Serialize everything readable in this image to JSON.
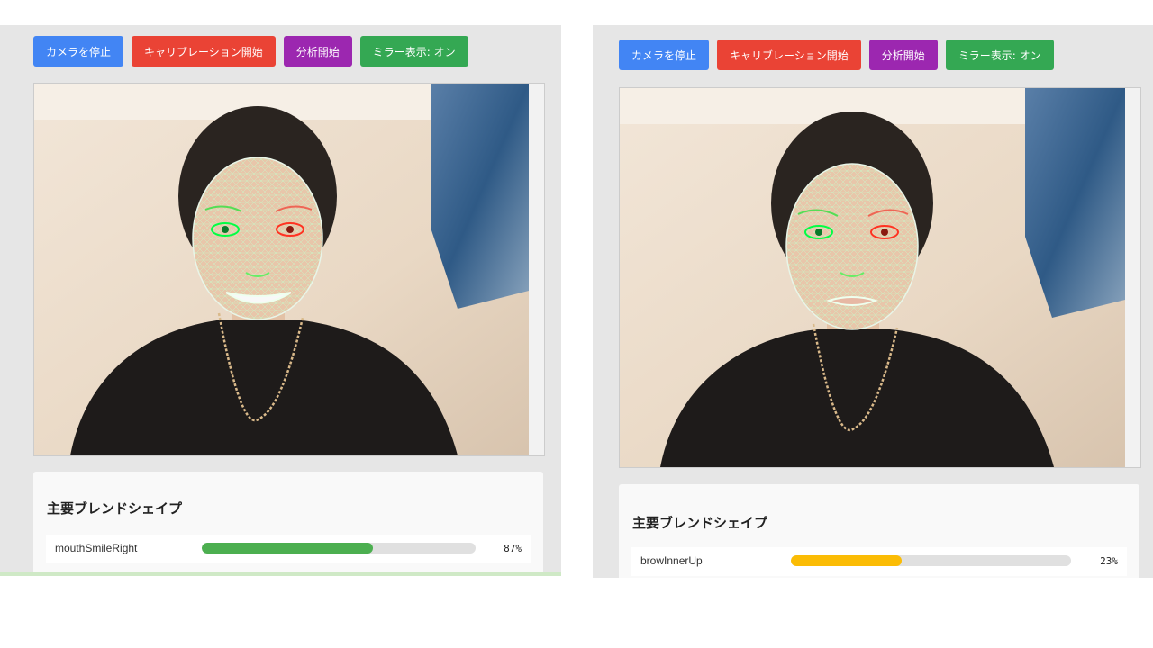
{
  "left_panel": {
    "buttons": {
      "stop_camera": "カメラを停止",
      "start_calibration": "キャリブレーション開始",
      "start_analysis": "分析開始",
      "mirror_display": "ミラー表示: オン"
    },
    "blendshapes": {
      "title": "主要ブレンドシェイプ",
      "items": [
        {
          "name": "mouthSmileRight",
          "value": 0.87,
          "percent_label": "87%",
          "color": "#4caf50"
        }
      ]
    }
  },
  "right_panel": {
    "buttons": {
      "stop_camera": "カメラを停止",
      "start_calibration": "キャリブレーション開始",
      "start_analysis": "分析開始",
      "mirror_display": "ミラー表示: オン"
    },
    "blendshapes": {
      "title": "主要ブレンドシェイプ",
      "items": [
        {
          "name": "browInnerUp",
          "value": 0.23,
          "percent_label": "23%",
          "color": "#fbbc05"
        }
      ]
    }
  },
  "colors": {
    "blue": "#4285f4",
    "red": "#ea4335",
    "purple": "#9c27b0",
    "green": "#34a853",
    "mesh": "#c8f7c8",
    "left_eye": "#00ff44",
    "right_eye": "#ff3322"
  }
}
